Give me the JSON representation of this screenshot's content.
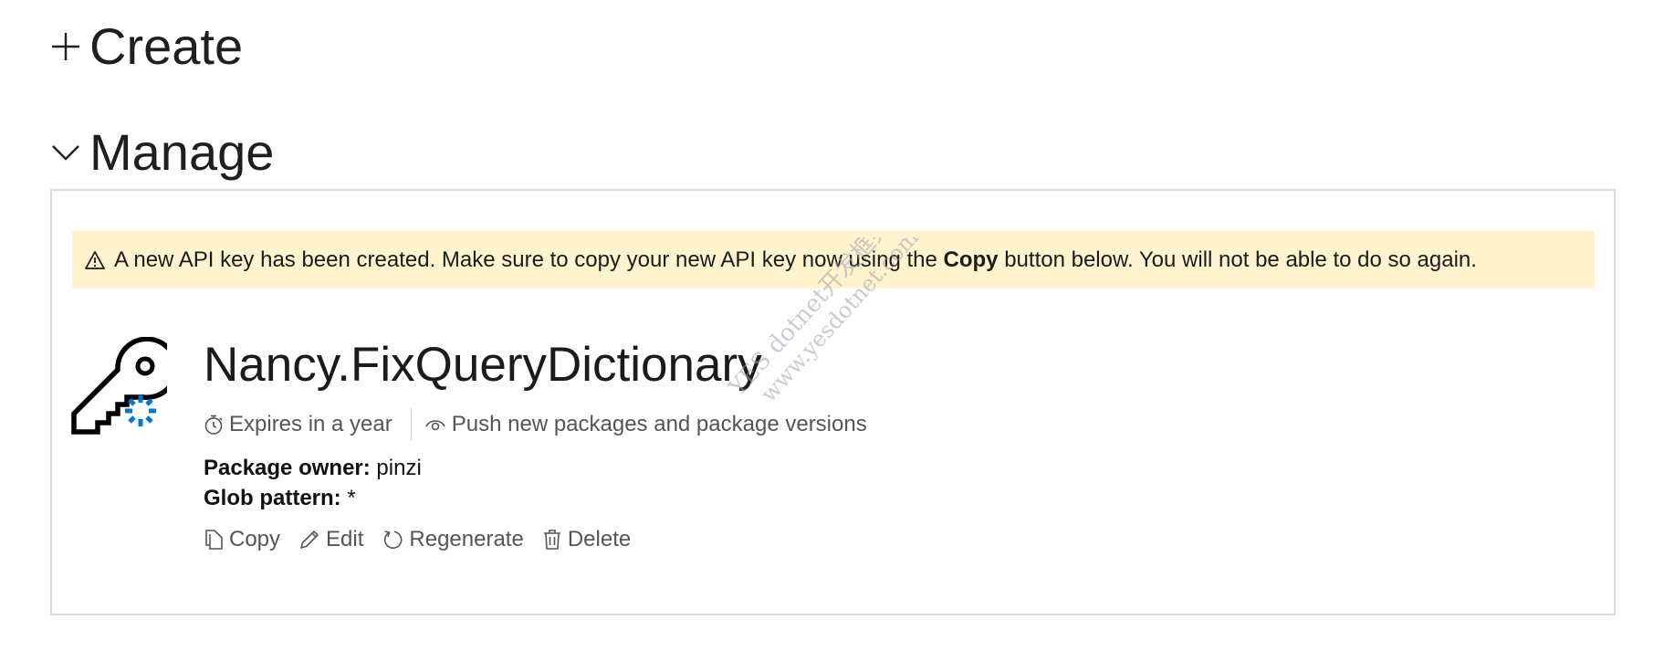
{
  "sections": {
    "create": {
      "icon": "plus-icon",
      "label": "Create"
    },
    "manage": {
      "icon": "chevron-down-icon",
      "label": "Manage"
    }
  },
  "alert": {
    "icon": "warning-icon",
    "text_before": "A new API key has been created. Make sure to copy your new API key now using the ",
    "text_bold": "Copy",
    "text_after": " button below. You will not be able to do so again.",
    "background": "#fff4ce"
  },
  "api_key": {
    "icon": "key-icon",
    "name": "Nancy.FixQueryDictionary",
    "expires": "Expires in a year",
    "scope": "Push new packages and package versions",
    "owner_label": "Package owner:",
    "owner_value": "pinzi",
    "glob_label": "Glob pattern:",
    "glob_value": "*"
  },
  "actions": [
    {
      "icon": "copy-icon",
      "label": "Copy"
    },
    {
      "icon": "edit-icon",
      "label": "Edit"
    },
    {
      "icon": "refresh-icon",
      "label": "Regenerate"
    },
    {
      "icon": "trash-icon",
      "label": "Delete"
    }
  ],
  "watermark": {
    "line1": "YES dotnet开发框架",
    "line2": "www.yesdotnet.com"
  },
  "colors": {
    "accent_blue": "#0078d4",
    "panel_border": "#dcdcdc"
  }
}
